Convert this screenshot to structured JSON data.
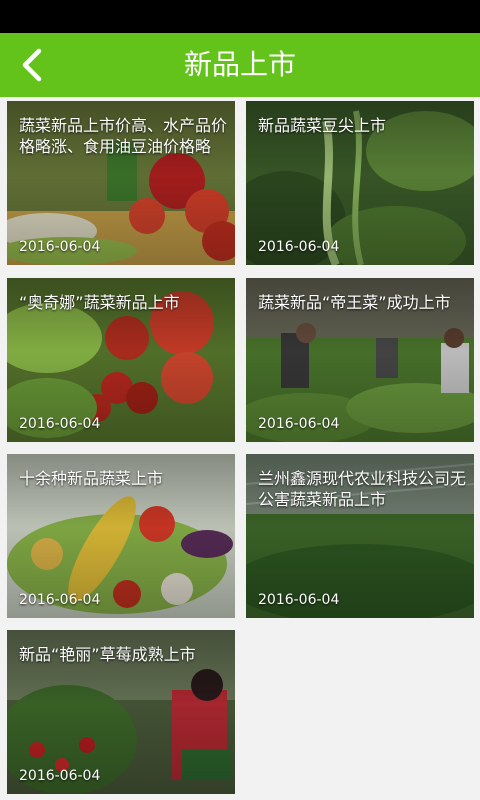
{
  "header": {
    "title": "新品上市",
    "back_icon": "chevron-left-icon",
    "bar_color": "#63c31a"
  },
  "articles": [
    {
      "title": "蔬菜新品上市价高、水产品价格略涨、食用油豆油价格略",
      "date": "2016-06-04"
    },
    {
      "title": "新品蔬菜豆尖上市",
      "date": "2016-06-04"
    },
    {
      "title": "“奥奇娜”蔬菜新品上市",
      "date": "2016-06-04"
    },
    {
      "title": "蔬菜新品“帝王菜”成功上市",
      "date": "2016-06-04"
    },
    {
      "title": "十余种新品蔬菜上市",
      "date": "2016-06-04"
    },
    {
      "title": "兰州鑫源现代农业科技公司无公害蔬菜新品上市",
      "date": "2016-06-04"
    },
    {
      "title": "新品“艳丽”草莓成熟上市",
      "date": "2016-06-04"
    }
  ]
}
